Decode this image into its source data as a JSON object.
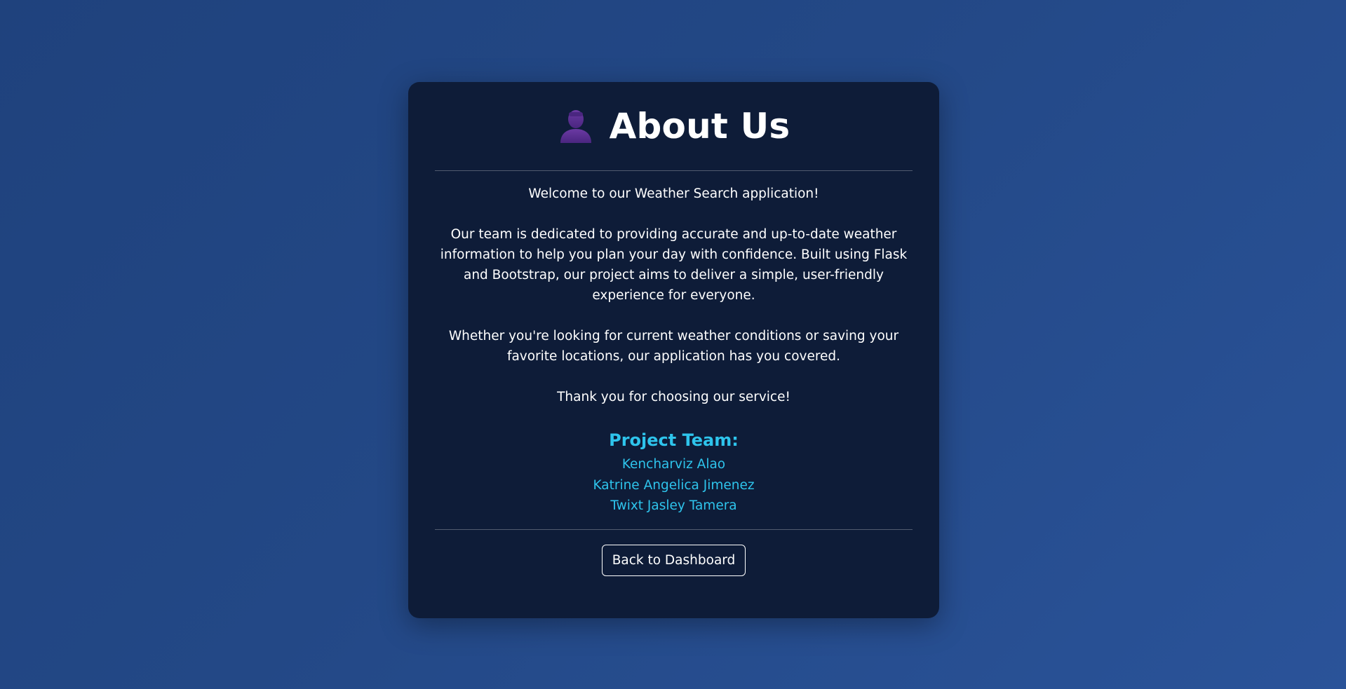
{
  "colors": {
    "background": "#234886",
    "card": "#0e1c38",
    "accent": "#2ec4ec",
    "icon": "#5b2f91"
  },
  "header": {
    "icon": "person-icon",
    "title": "About Us"
  },
  "content": {
    "paragraphs": [
      "Welcome to our Weather Search application!",
      "Our team is dedicated to providing accurate and up-to-date weather information to help you plan your day with confidence. Built using Flask and Bootstrap, our project aims to deliver a simple, user-friendly experience for everyone.",
      "Whether you're looking for current weather conditions or saving your favorite locations, our application has you covered.",
      "Thank you for choosing our service!"
    ]
  },
  "team": {
    "heading": "Project Team:",
    "members": [
      "Kencharviz Alao",
      "Katrine Angelica Jimenez",
      "Twixt Jasley Tamera"
    ]
  },
  "actions": {
    "back_label": "Back to Dashboard"
  }
}
